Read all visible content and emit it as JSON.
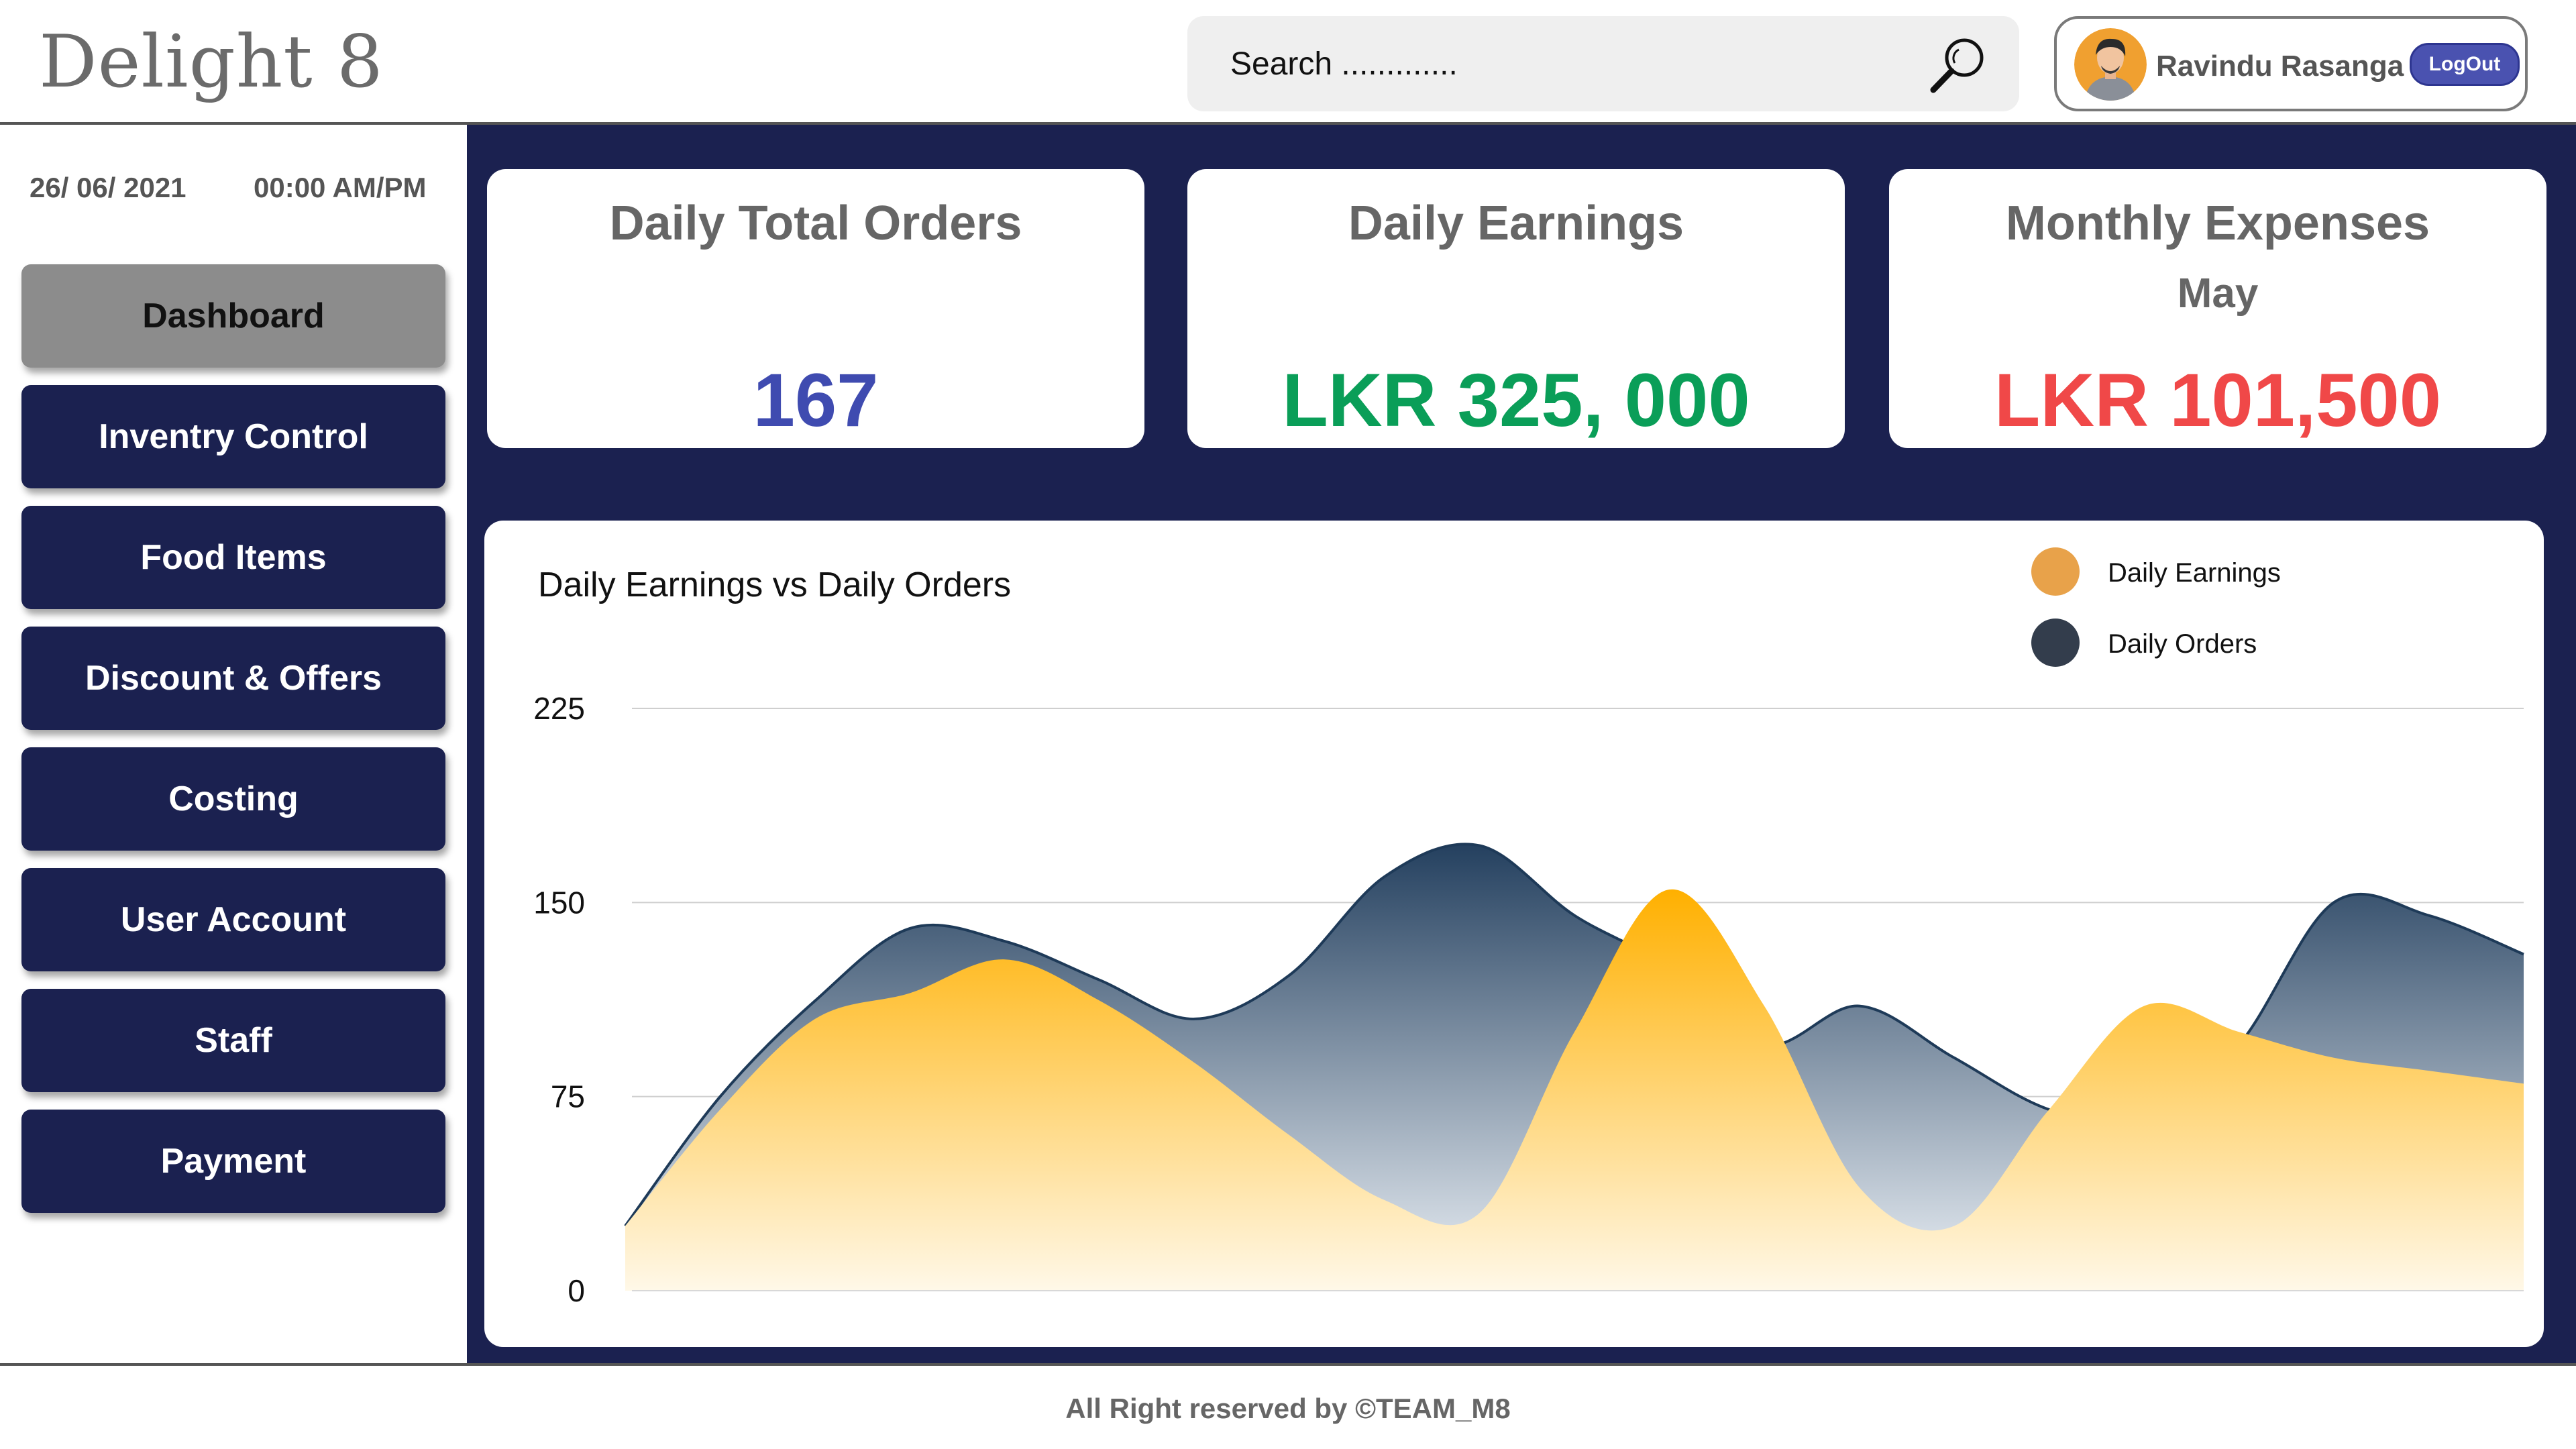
{
  "app": {
    "title": "Delight 8"
  },
  "search": {
    "placeholder": "Search ............."
  },
  "user": {
    "name": "Ravindu Rasanga",
    "logout_label": "LogOut"
  },
  "sidebar": {
    "date": "26/ 06/ 2021",
    "time": "00:00 AM/PM",
    "items": [
      {
        "label": "Dashboard",
        "active": true
      },
      {
        "label": "Inventry Control"
      },
      {
        "label": "Food Items"
      },
      {
        "label": "Discount & Offers"
      },
      {
        "label": "Costing"
      },
      {
        "label": "User Account"
      },
      {
        "label": "Staff"
      },
      {
        "label": "Payment"
      }
    ]
  },
  "cards": [
    {
      "title": "Daily Total Orders",
      "value": "167",
      "color": "#3f4bb0"
    },
    {
      "title": "Daily Earnings",
      "value": "LKR 325, 000",
      "color": "#0a9e58"
    },
    {
      "title": "Monthly Expenses",
      "subtitle": "May",
      "value": "LKR 101,500",
      "color": "#f04848"
    }
  ],
  "chart_data": {
    "type": "area",
    "title": "Daily Earnings vs Daily Orders",
    "legend_position": "top-right",
    "yticks": [
      0,
      75,
      150,
      225
    ],
    "ylim": [
      0,
      225
    ],
    "grid": true,
    "x": [
      0,
      1,
      2,
      3,
      4,
      5,
      6,
      7,
      8,
      9,
      10,
      11,
      12,
      13,
      14,
      15,
      16,
      17,
      18,
      19,
      20
    ],
    "series": [
      {
        "name": "Daily Orders",
        "color": "#2f4a6a",
        "values": [
          25,
          75,
          112,
          140,
          135,
          120,
          105,
          122,
          160,
          172,
          145,
          125,
          95,
          110,
          90,
          70,
          65,
          95,
          150,
          145,
          130
        ]
      },
      {
        "name": "Daily Earnings",
        "color": "#ffb300",
        "values": [
          25,
          70,
          105,
          115,
          128,
          112,
          88,
          60,
          35,
          30,
          100,
          155,
          110,
          40,
          25,
          70,
          110,
          100,
          90,
          85,
          80
        ]
      }
    ]
  },
  "footer": {
    "text": "All Right reserved by ©TEAM_M8"
  }
}
